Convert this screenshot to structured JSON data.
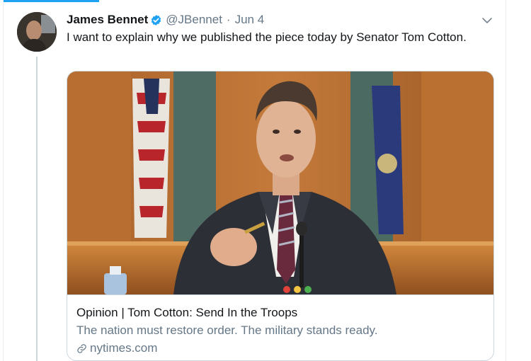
{
  "tweet": {
    "author": {
      "name": "James Bennet",
      "handle": "@JBennet",
      "verified": true
    },
    "separator": "·",
    "date": "Jun 4",
    "text": "I want to explain why we published the piece today by Senator Tom Cotton."
  },
  "card": {
    "title": "Opinion | Tom Cotton: Send In the Troops",
    "description": "The nation must restore order. The military stands ready.",
    "domain": "nytimes.com"
  },
  "colors": {
    "accent": "#1da1f2",
    "secondary_text": "#657786",
    "border": "#ccd6dd"
  },
  "icons": {
    "verified": "verified-badge-icon",
    "menu": "chevron-down-icon",
    "link": "link-icon"
  }
}
